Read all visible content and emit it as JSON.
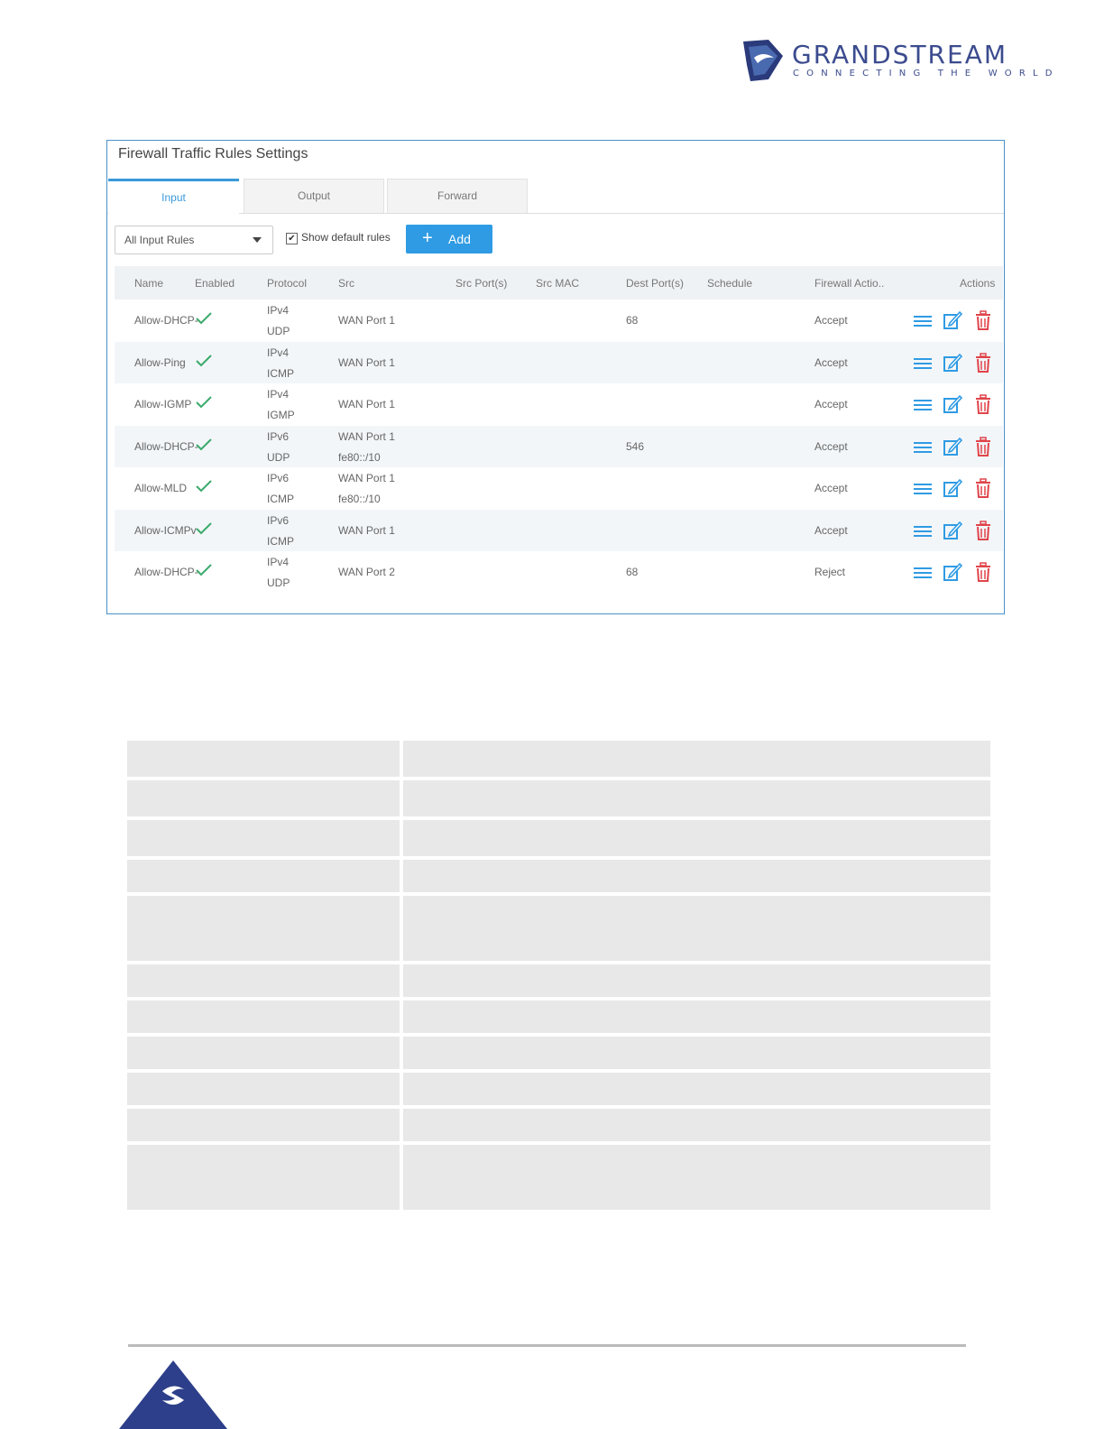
{
  "brand": {
    "name": "GRANDSTREAM",
    "tagline": "CONNECTING THE WORLD",
    "colors": {
      "primary": "#3b4b8e"
    }
  },
  "panel": {
    "title": "Firewall Traffic Rules Settings",
    "tabs": [
      {
        "label": "Input",
        "active": true
      },
      {
        "label": "Output",
        "active": false
      },
      {
        "label": "Forward",
        "active": false
      }
    ],
    "filter": {
      "selected": "All Input Rules"
    },
    "show_default": {
      "label": "Show default rules",
      "checked": true,
      "mark": "✔"
    },
    "add_button": {
      "icon": "plus-icon",
      "label": "Add",
      "plus": "+"
    },
    "columns": [
      "Name",
      "Enabled",
      "Protocol",
      "Src",
      "Src Port(s)",
      "Src MAC",
      "Dest Port(s)",
      "Schedule",
      "Firewall Actio..",
      "Actions"
    ],
    "rows": [
      {
        "name": "Allow-DHCP-",
        "proto1": "IPv4",
        "proto2": "UDP",
        "src1": "WAN Port 1",
        "src2": "",
        "dest": "68",
        "action": "Accept"
      },
      {
        "name": "Allow-Ping",
        "proto1": "IPv4",
        "proto2": "ICMP",
        "src1": "WAN Port 1",
        "src2": "",
        "dest": "",
        "action": "Accept"
      },
      {
        "name": "Allow-IGMP",
        "proto1": "IPv4",
        "proto2": "IGMP",
        "src1": "WAN Port 1",
        "src2": "",
        "dest": "",
        "action": "Accept"
      },
      {
        "name": "Allow-DHCP-",
        "proto1": "IPv6",
        "proto2": "UDP",
        "src1": "WAN Port 1",
        "src2": "fe80::/10",
        "dest": "546",
        "action": "Accept"
      },
      {
        "name": "Allow-MLD",
        "proto1": "IPv6",
        "proto2": "ICMP",
        "src1": "WAN Port 1",
        "src2": "fe80::/10",
        "dest": "",
        "action": "Accept"
      },
      {
        "name": "Allow-ICMPv",
        "proto1": "IPv6",
        "proto2": "ICMP",
        "src1": "WAN Port 1",
        "src2": "",
        "dest": "",
        "action": "Accept"
      },
      {
        "name": "Allow-DHCP-",
        "proto1": "IPv4",
        "proto2": "UDP",
        "src1": "WAN Port 2",
        "src2": "",
        "dest": "68",
        "action": "Reject"
      }
    ],
    "colors": {
      "accent": "#2f9be4",
      "check": "#3aaa6a",
      "delete": "#e0444b",
      "border": "#4a90c8"
    }
  }
}
